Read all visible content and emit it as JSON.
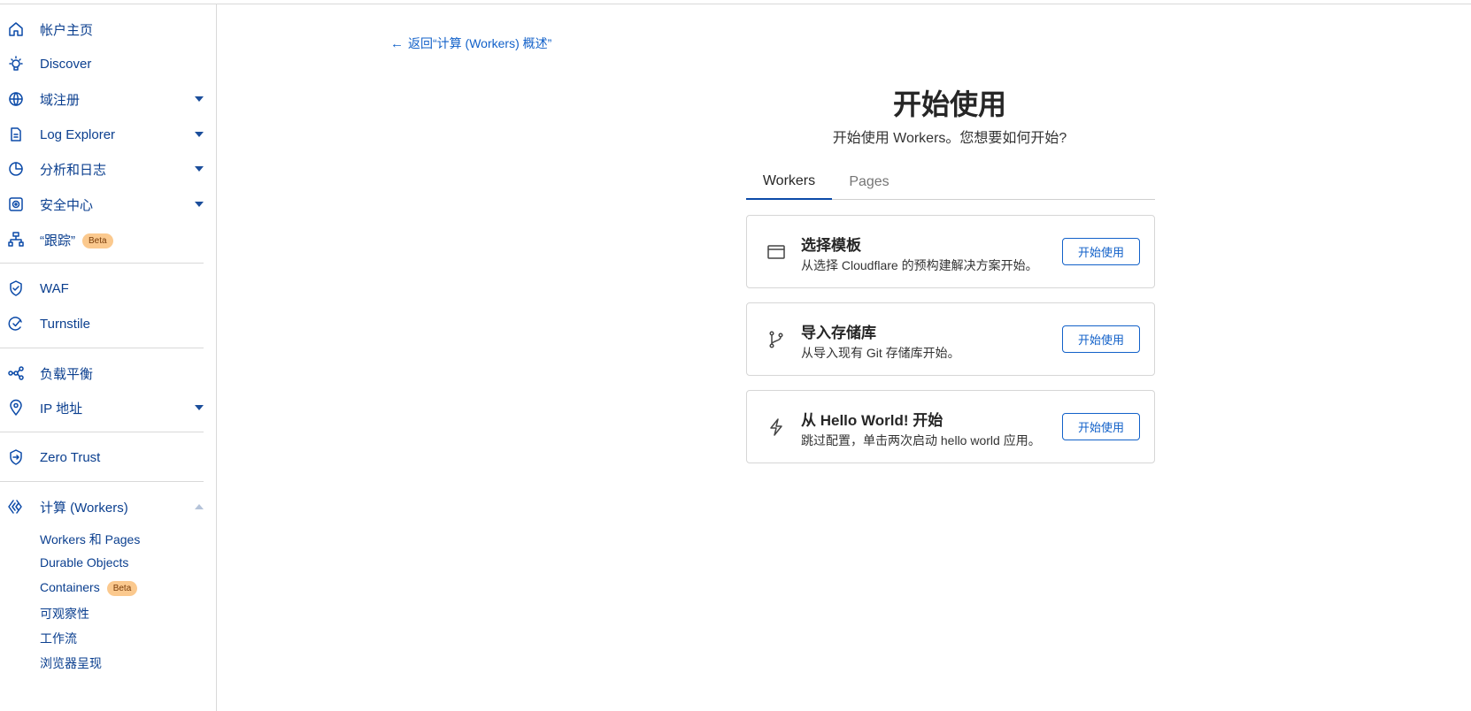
{
  "sidebar": {
    "items": [
      {
        "label": "帐户主页",
        "icon": "home-icon"
      },
      {
        "label": "Discover",
        "icon": "lightbulb-icon"
      },
      {
        "label": "域注册",
        "icon": "globe-icon"
      },
      {
        "label": "Log Explorer",
        "icon": "log-document-icon"
      },
      {
        "label": "分析和日志",
        "icon": "pie-chart-icon"
      },
      {
        "label": "安全中心",
        "icon": "security-center-icon"
      },
      {
        "label": "“跟踪”",
        "icon": "trace-tree-icon",
        "badge": "Beta"
      },
      {
        "label": "WAF",
        "icon": "waf-shield-icon"
      },
      {
        "label": "Turnstile",
        "icon": "turnstile-check-icon"
      },
      {
        "label": "负载平衡",
        "icon": "load-balancer-icon"
      },
      {
        "label": "IP 地址",
        "icon": "location-pin-icon"
      },
      {
        "label": "Zero Trust",
        "icon": "zero-trust-icon"
      },
      {
        "label": "计算 (Workers)",
        "icon": "workers-icon"
      }
    ],
    "sub_items": [
      {
        "label": "Workers 和 Pages"
      },
      {
        "label": "Durable Objects"
      },
      {
        "label": "Containers",
        "badge": "Beta"
      },
      {
        "label": "可观察性"
      },
      {
        "label": "工作流"
      },
      {
        "label": "浏览器呈现"
      }
    ]
  },
  "main": {
    "back_link": "返回“计算 (Workers) 概述”",
    "title": "开始使用",
    "subtitle": "开始使用 Workers。您想要如何开始?",
    "tabs": [
      {
        "label": "Workers",
        "active": true
      },
      {
        "label": "Pages",
        "active": false
      }
    ],
    "cards": [
      {
        "icon": "browser-window-icon",
        "title": "选择模板",
        "description": "从选择 Cloudflare 的预构建解决方案开始。",
        "button": "开始使用"
      },
      {
        "icon": "git-branch-icon",
        "title": "导入存储库",
        "description": "从导入现有 Git 存储库开始。",
        "button": "开始使用"
      },
      {
        "icon": "lightning-icon",
        "title": "从 Hello World! 开始",
        "description": "跳过配置，单击两次启动 hello world 应用。",
        "button": "开始使用"
      }
    ]
  },
  "colors": {
    "accent": "#1261c9",
    "nav_text": "#0b3f8f",
    "badge_bg": "#fbc98e",
    "border": "#d6d6d6"
  }
}
